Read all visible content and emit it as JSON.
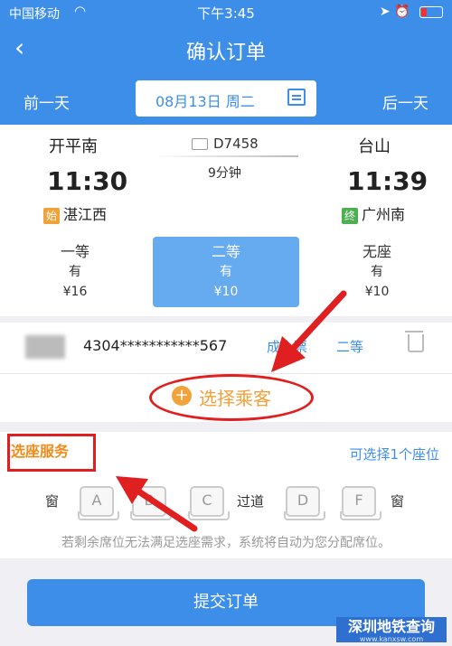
{
  "status_bar": {
    "carrier": "中国移动",
    "time": "下午3:45"
  },
  "nav": {
    "back": "‹",
    "title": "确认订单"
  },
  "date_bar": {
    "prev": "前一天",
    "date": "08月13日 周二",
    "next": "后一天"
  },
  "train": {
    "from_station": "开平南",
    "to_station": "台山",
    "number": "D7458",
    "duration": "9分钟",
    "depart_time": "11:30",
    "arrive_time": "11:39",
    "origin_badge": "始",
    "origin_station": "湛江西",
    "terminal_badge": "终",
    "terminal_station": "广州南"
  },
  "seat_classes": [
    {
      "name": "一等",
      "availability": "有",
      "price": "¥16",
      "selected": false
    },
    {
      "name": "二等",
      "availability": "有",
      "price": "¥10",
      "selected": true
    },
    {
      "name": "无座",
      "availability": "有",
      "price": "¥10",
      "selected": false
    }
  ],
  "passenger": {
    "id": "4304***********567",
    "type": "成人票",
    "seat": "二等"
  },
  "add_passenger": "选择乘客",
  "seat_service": {
    "title": "选座服务",
    "available": "可选择1个座位",
    "window_left": "窗",
    "aisle": "过道",
    "window_right": "窗",
    "seats": [
      "A",
      "B",
      "C",
      "D",
      "F"
    ],
    "hint": "若剩余席位无法满足选座需求，系统将自动为您分配席位。"
  },
  "submit": "提交订单",
  "watermark": {
    "title": "深圳地铁查询",
    "url": "www.kanxsw.com"
  },
  "colors": {
    "primary": "#3d8ee8",
    "accent": "#f2a23a",
    "annotation": "#e02020"
  }
}
